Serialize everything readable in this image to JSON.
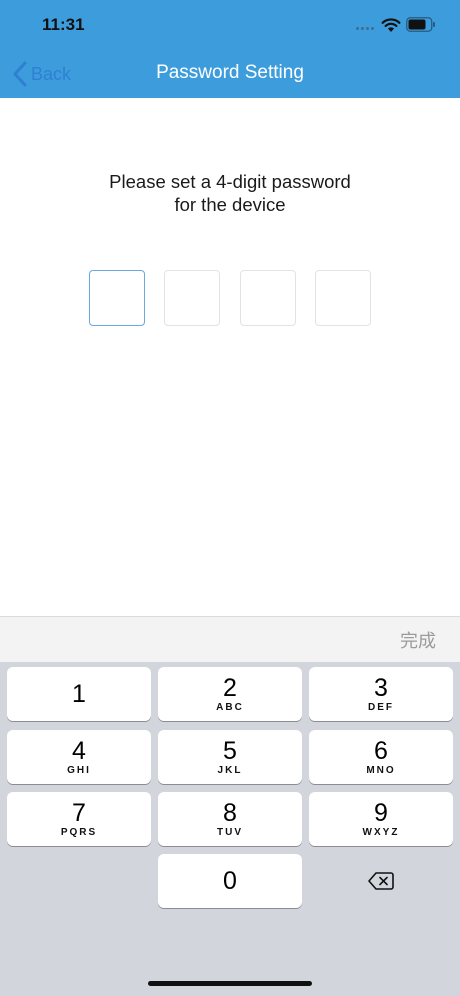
{
  "status_bar": {
    "time": "11:31",
    "signal_icon": "cellular-signal-icon",
    "wifi_icon": "wifi-icon",
    "battery_icon": "battery-icon"
  },
  "nav": {
    "back_label": "Back",
    "back_icon": "chevron-left-icon",
    "title": "Password Setting"
  },
  "main": {
    "prompt_line1": "Please set a 4-digit password",
    "prompt_line2": "for the device",
    "pin_length": 4,
    "pin_value": ""
  },
  "keyboard": {
    "done_label": "完成",
    "keys": [
      {
        "num": "1",
        "letters": ""
      },
      {
        "num": "2",
        "letters": "ABC"
      },
      {
        "num": "3",
        "letters": "DEF"
      },
      {
        "num": "4",
        "letters": "GHI"
      },
      {
        "num": "5",
        "letters": "JKL"
      },
      {
        "num": "6",
        "letters": "MNO"
      },
      {
        "num": "7",
        "letters": "PQRS"
      },
      {
        "num": "8",
        "letters": "TUV"
      },
      {
        "num": "9",
        "letters": "WXYZ"
      },
      {
        "num": "0",
        "letters": ""
      }
    ],
    "delete_icon": "backspace-icon"
  },
  "colors": {
    "header_bg": "#3d9ddc",
    "back_link": "#2f7fd3",
    "active_box_border": "#6aa8de",
    "keyboard_bg": "#d2d5db"
  }
}
